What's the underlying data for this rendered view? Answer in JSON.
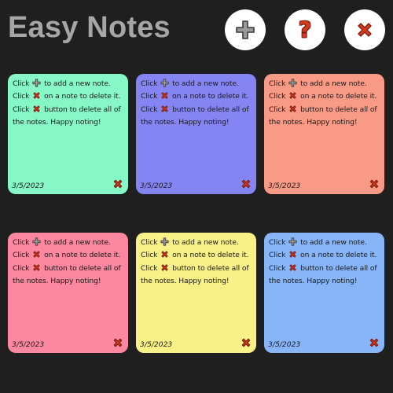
{
  "app": {
    "title": "Easy Notes"
  },
  "toolbar": {
    "add_icon": "plus-icon",
    "help_label": "?",
    "clear_icon": "cross-icon"
  },
  "colors": {
    "background": "#1f1f1f",
    "title": "#a6a6a6",
    "delete_red": "#d83a1f"
  },
  "note_text": {
    "w1": "Click",
    "w2": "to add a new note.",
    "w3": "Click",
    "w4": "on a note to delete it.",
    "w5": "Click",
    "w6": "button to delete all of the notes. Happy noting!"
  },
  "notes": [
    {
      "date": "3/5/2023",
      "color": "#87f7c8"
    },
    {
      "date": "3/5/2023",
      "color": "#8584f3"
    },
    {
      "date": "3/5/2023",
      "color": "#f99a86"
    },
    {
      "date": "3/5/2023",
      "color": "#fb87a0"
    },
    {
      "date": "3/5/2023",
      "color": "#f8f187"
    },
    {
      "date": "3/5/2023",
      "color": "#87b5f8"
    }
  ]
}
